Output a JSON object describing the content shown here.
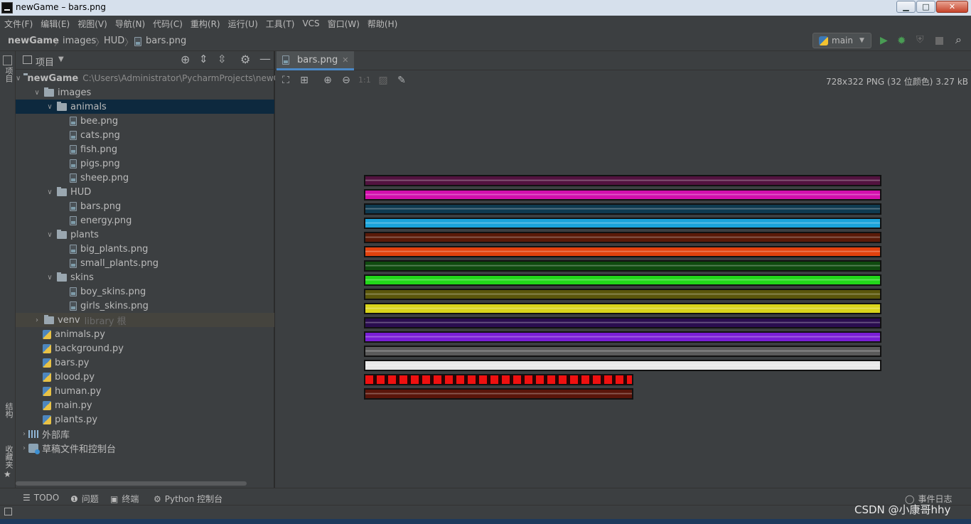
{
  "window": {
    "title": "newGame – bars.png",
    "btn_min": "▁",
    "btn_max": "□",
    "btn_close": "✕"
  },
  "menu": [
    "文件(F)",
    "编辑(E)",
    "视图(V)",
    "导航(N)",
    "代码(C)",
    "重构(R)",
    "运行(U)",
    "工具(T)",
    "VCS",
    "窗口(W)",
    "帮助(H)"
  ],
  "breadcrumbs": [
    "newGame",
    "images",
    "HUD",
    "bars.png"
  ],
  "run_config": "main",
  "left_strip": {
    "project": "项目",
    "structure": "结构",
    "favorites": "收藏夹"
  },
  "project_panel": {
    "title": "项目"
  },
  "tree": [
    {
      "label": "newGame",
      "path": "C:\\Users\\Administrator\\PycharmProjects\\newGame",
      "kind": "folder",
      "expanded": true
    },
    {
      "label": "images",
      "kind": "folder",
      "expanded": true
    },
    {
      "label": "animals",
      "kind": "folder",
      "expanded": true,
      "selected": true
    },
    {
      "label": "bee.png",
      "kind": "image"
    },
    {
      "label": "cats.png",
      "kind": "image"
    },
    {
      "label": "fish.png",
      "kind": "image"
    },
    {
      "label": "pigs.png",
      "kind": "image"
    },
    {
      "label": "sheep.png",
      "kind": "image"
    },
    {
      "label": "HUD",
      "kind": "folder",
      "expanded": true
    },
    {
      "label": "bars.png",
      "kind": "image"
    },
    {
      "label": "energy.png",
      "kind": "image"
    },
    {
      "label": "plants",
      "kind": "folder",
      "expanded": true
    },
    {
      "label": "big_plants.png",
      "kind": "image"
    },
    {
      "label": "small_plants.png",
      "kind": "image"
    },
    {
      "label": "skins",
      "kind": "folder",
      "expanded": true
    },
    {
      "label": "boy_skins.png",
      "kind": "image"
    },
    {
      "label": "girls_skins.png",
      "kind": "image"
    },
    {
      "label": "venv",
      "suffix": "library 根",
      "kind": "folder",
      "expanded": false
    },
    {
      "label": "animals.py",
      "kind": "python"
    },
    {
      "label": "background.py",
      "kind": "python"
    },
    {
      "label": "bars.py",
      "kind": "python"
    },
    {
      "label": "blood.py",
      "kind": "python"
    },
    {
      "label": "human.py",
      "kind": "python"
    },
    {
      "label": "main.py",
      "kind": "python"
    },
    {
      "label": "plants.py",
      "kind": "python"
    },
    {
      "label": "外部库",
      "kind": "library",
      "expanded": false
    },
    {
      "label": "草稿文件和控制台",
      "kind": "scratch",
      "expanded": false
    }
  ],
  "editor": {
    "tab": "bars.png",
    "image_info": "728x322 PNG (32 位颜色) 3.27 kB",
    "zoom_actual": "1:1"
  },
  "bars_image": {
    "bars": [
      {
        "color": "#52123f",
        "fill": 1.0
      },
      {
        "color": "#d30fad",
        "fill": 1.0
      },
      {
        "color": "#0f3a50",
        "fill": 1.0
      },
      {
        "color": "#1ba3da",
        "fill": 1.0
      },
      {
        "color": "#5a1a08",
        "fill": 1.0
      },
      {
        "color": "#e2420e",
        "fill": 1.0
      },
      {
        "color": "#0f4a0f",
        "fill": 1.0
      },
      {
        "color": "#22d71a",
        "fill": 1.0
      },
      {
        "color": "#5a560a",
        "fill": 1.0
      },
      {
        "color": "#d9d41b",
        "fill": 1.0
      },
      {
        "color": "#2a0d4f",
        "fill": 1.0
      },
      {
        "color": "#7a1ed6",
        "fill": 1.0
      },
      {
        "color": "#5a5a5a",
        "fill": 1.0
      },
      {
        "color": "#e8e8e8",
        "fill": 1.0
      },
      {
        "color": "#ef1010",
        "fill": 0.52,
        "segmented": true
      },
      {
        "color": "#5a150a",
        "fill": 0.52
      }
    ]
  },
  "bottom_tools": [
    "TODO",
    "问题",
    "终端",
    "Python 控制台"
  ],
  "event_log": "事件日志",
  "watermark": "CSDN @小康哥hhy"
}
